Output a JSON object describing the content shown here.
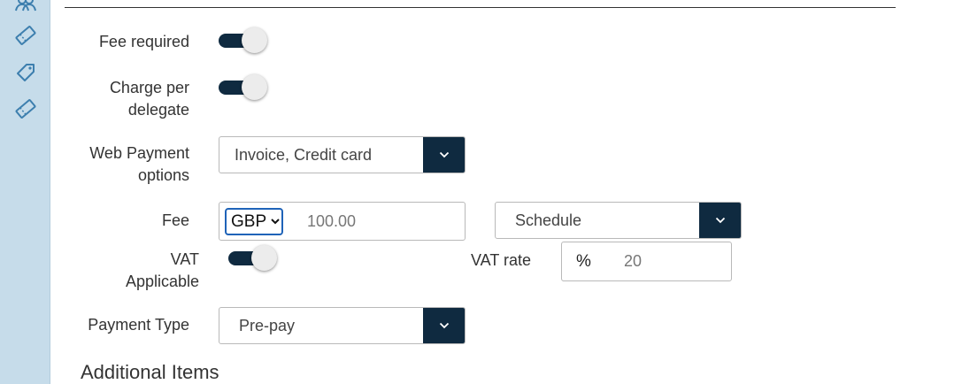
{
  "sidebar": {
    "icons": [
      {
        "name": "users-icon"
      },
      {
        "name": "ticket-icon"
      },
      {
        "name": "tag-icon"
      },
      {
        "name": "ticket-icon"
      }
    ]
  },
  "form": {
    "fee_required": {
      "label": "Fee required",
      "on": true
    },
    "charge_per_delegate": {
      "label_line1": "Charge per",
      "label_line2": "delegate",
      "on": true
    },
    "web_payment": {
      "label_line1": "Web Payment",
      "label_line2": "options",
      "value": "Invoice, Credit card"
    },
    "fee": {
      "label": "Fee",
      "currency": "GBP",
      "amount": "100.00",
      "schedule": "Schedule"
    },
    "vat_applicable": {
      "label_line1": "VAT",
      "label_line2": "Applicable",
      "on": true
    },
    "vat_rate": {
      "label": "VAT rate",
      "symbol": "%",
      "value": "20"
    },
    "payment_type": {
      "label": "Payment Type",
      "value": "Pre-pay"
    }
  },
  "sections": {
    "additional_items": "Additional Items"
  },
  "colors": {
    "sidebar_bg": "#c6dcea",
    "accent_dark": "#0f2a40",
    "focus_blue": "#1f63b8"
  }
}
